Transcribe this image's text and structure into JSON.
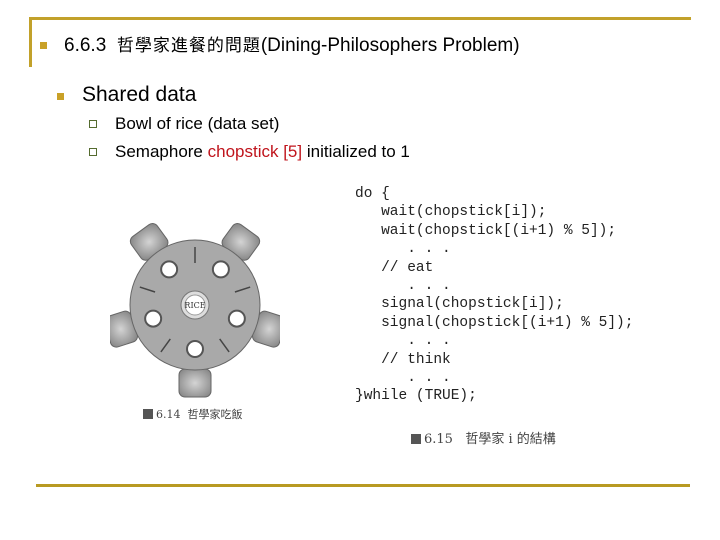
{
  "slide": {
    "title_number": "6.6.3",
    "title_cjk": "哲學家進餐的問題",
    "title_en": "(Dining-Philosophers Problem)",
    "level1": "Shared data",
    "items": [
      {
        "text": "Bowl of rice (data set)"
      },
      {
        "prefix": "Semaphore ",
        "highlight": "chopstick [5]",
        "suffix": " initialized to 1"
      }
    ],
    "colors": {
      "accent": "#c2a12a",
      "highlight": "#c0141c"
    }
  },
  "figure_left": {
    "center_label": "RICE",
    "caption_num": "6.14",
    "caption_text": "哲學家吃飯",
    "philosophers": 5,
    "chopsticks": 5
  },
  "figure_right": {
    "code_lines": [
      "do {",
      "   wait(chopstick[i]);",
      "   wait(chopstick[(i+1) % 5]);",
      "      . . .",
      "   // eat",
      "      . . .",
      "   signal(chopstick[i]);",
      "   signal(chopstick[(i+1) % 5]);",
      "      . . .",
      "   // think",
      "      . . .",
      "}while (TRUE);"
    ],
    "caption_num": "6.15",
    "caption_text": "哲學家 i 的結構"
  }
}
